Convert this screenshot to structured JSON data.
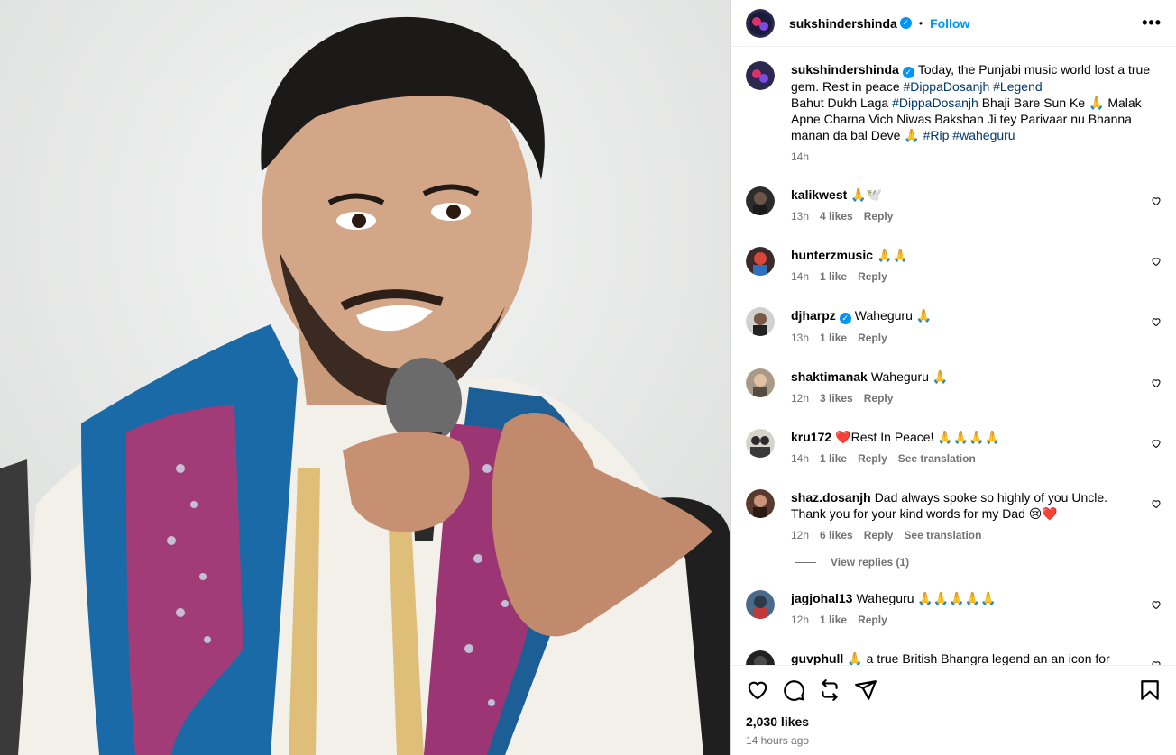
{
  "post": {
    "author": "sukshindershinda",
    "follow_label": "Follow",
    "more_label": "•••",
    "dot": "•",
    "verified": true
  },
  "caption": {
    "username": "sukshindershinda",
    "line1": "Today, the Punjabi music world lost a true gem. Rest in peace",
    "tags1": "#DippaDosanjh #Legend",
    "line2a": "Bahut Dukh Laga",
    "tag2": "#DippaDosanjh",
    "line2b": "Bhaji Bare Sun Ke 🙏 Malak Apne Charna Vich Niwas Bakshan Ji tey Parivaar nu Bhanna manan da bal Deve 🙏",
    "tags3": "#Rip #waheguru",
    "time": "14h"
  },
  "comments": [
    {
      "user": "kalikwest",
      "text": "🙏🕊️",
      "time": "13h",
      "likes": "4 likes",
      "reply": "Reply",
      "translate": ""
    },
    {
      "user": "hunterzmusic",
      "text": "🙏🙏",
      "time": "14h",
      "likes": "1 like",
      "reply": "Reply",
      "translate": ""
    },
    {
      "user": "djharpz",
      "text": "Waheguru 🙏",
      "time": "13h",
      "likes": "1 like",
      "reply": "Reply",
      "translate": "",
      "verified": true
    },
    {
      "user": "shaktimanak",
      "text": "Waheguru 🙏",
      "time": "12h",
      "likes": "3 likes",
      "reply": "Reply",
      "translate": ""
    },
    {
      "user": "kru172",
      "text": "❤️Rest In Peace! 🙏🙏🙏🙏",
      "time": "14h",
      "likes": "1 like",
      "reply": "Reply",
      "translate": "See translation"
    },
    {
      "user": "shaz.dosanjh",
      "text": "Dad always spoke so highly of you Uncle. Thank you for your kind words for my Dad 😢❤️",
      "time": "12h",
      "likes": "6 likes",
      "reply": "Reply",
      "translate": "See translation"
    },
    {
      "user": "jagjohal13",
      "text": "Waheguru 🙏🙏🙏🙏🙏",
      "time": "12h",
      "likes": "1 like",
      "reply": "Reply",
      "translate": ""
    },
    {
      "user": "guvphull",
      "text": "🙏 a true British Bhangra legend an an icon for",
      "time": "",
      "likes": "",
      "reply": "",
      "translate": ""
    }
  ],
  "view_replies": "View replies (1)",
  "footer": {
    "likes": "2,030 likes",
    "ago": "14 hours ago"
  },
  "colors": {
    "accent": "#0095f6",
    "hashtag": "#00376b",
    "muted": "#737373"
  },
  "icons": [
    "heart-icon",
    "comment-icon",
    "repost-icon",
    "share-icon",
    "bookmark-icon",
    "verified-badge-icon",
    "more-icon"
  ]
}
